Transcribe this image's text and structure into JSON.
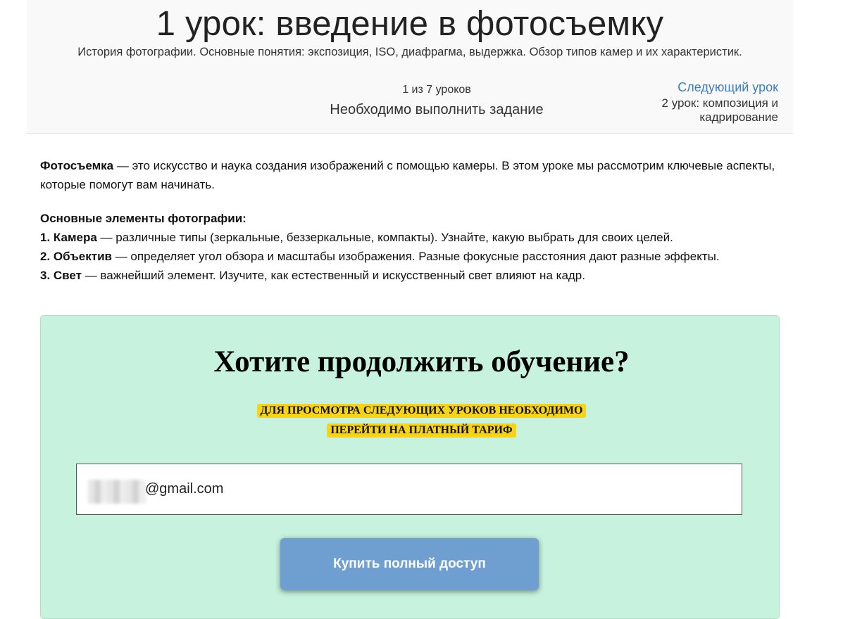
{
  "header": {
    "title": "1 урок: введение в фотосъемку",
    "subtitle": "История фотографии. Основные понятия: экспозиция, ISO, диафрагма, выдержка. Обзор типов камер и их характеристик.",
    "progress": "1 из 7 уроков",
    "task_required": "Необходимо выполнить задание",
    "next_link": "Следующий урок",
    "next_name": "2 урок: композиция и кадрирование"
  },
  "content": {
    "intro_term": "Фотосъемка",
    "intro_text": " — это искусство и наука создания изображений с помощью камеры. В этом уроке мы рассмотрим ключевые аспекты, которые помогут вам начинать.",
    "elements_heading": "Основные элементы фотографии:",
    "items": [
      {
        "term": "1. Камера",
        "text": " — различные типы (зеркальные, беззеркальные, компакты). Узнайте, какую выбрать для своих целей."
      },
      {
        "term": "2. Объектив",
        "text": " — определяет угол обзора и масштабы изображения. Разные фокусные расстояния дают разные эффекты."
      },
      {
        "term": "3. Свет",
        "text": " — важнейший элемент. Изучите, как естественный и искусственный свет влияют на кадр."
      }
    ]
  },
  "cta": {
    "title": "Хотите продолжить обучение?",
    "notice_line1": "ДЛЯ ПРОСМОТРА СЛЕДУЮЩИХ УРОКОВ НЕОБХОДИМО",
    "notice_line2": "ПЕРЕЙТИ НА ПЛАТНЫЙ ТАРИФ",
    "email_visible": "@gmail.com",
    "button_label": "Купить полный доступ"
  },
  "colors": {
    "cta_background": "#c6f2de",
    "highlight": "#f7d417",
    "button": "#6f9fd0",
    "link": "#3d7fb8"
  }
}
